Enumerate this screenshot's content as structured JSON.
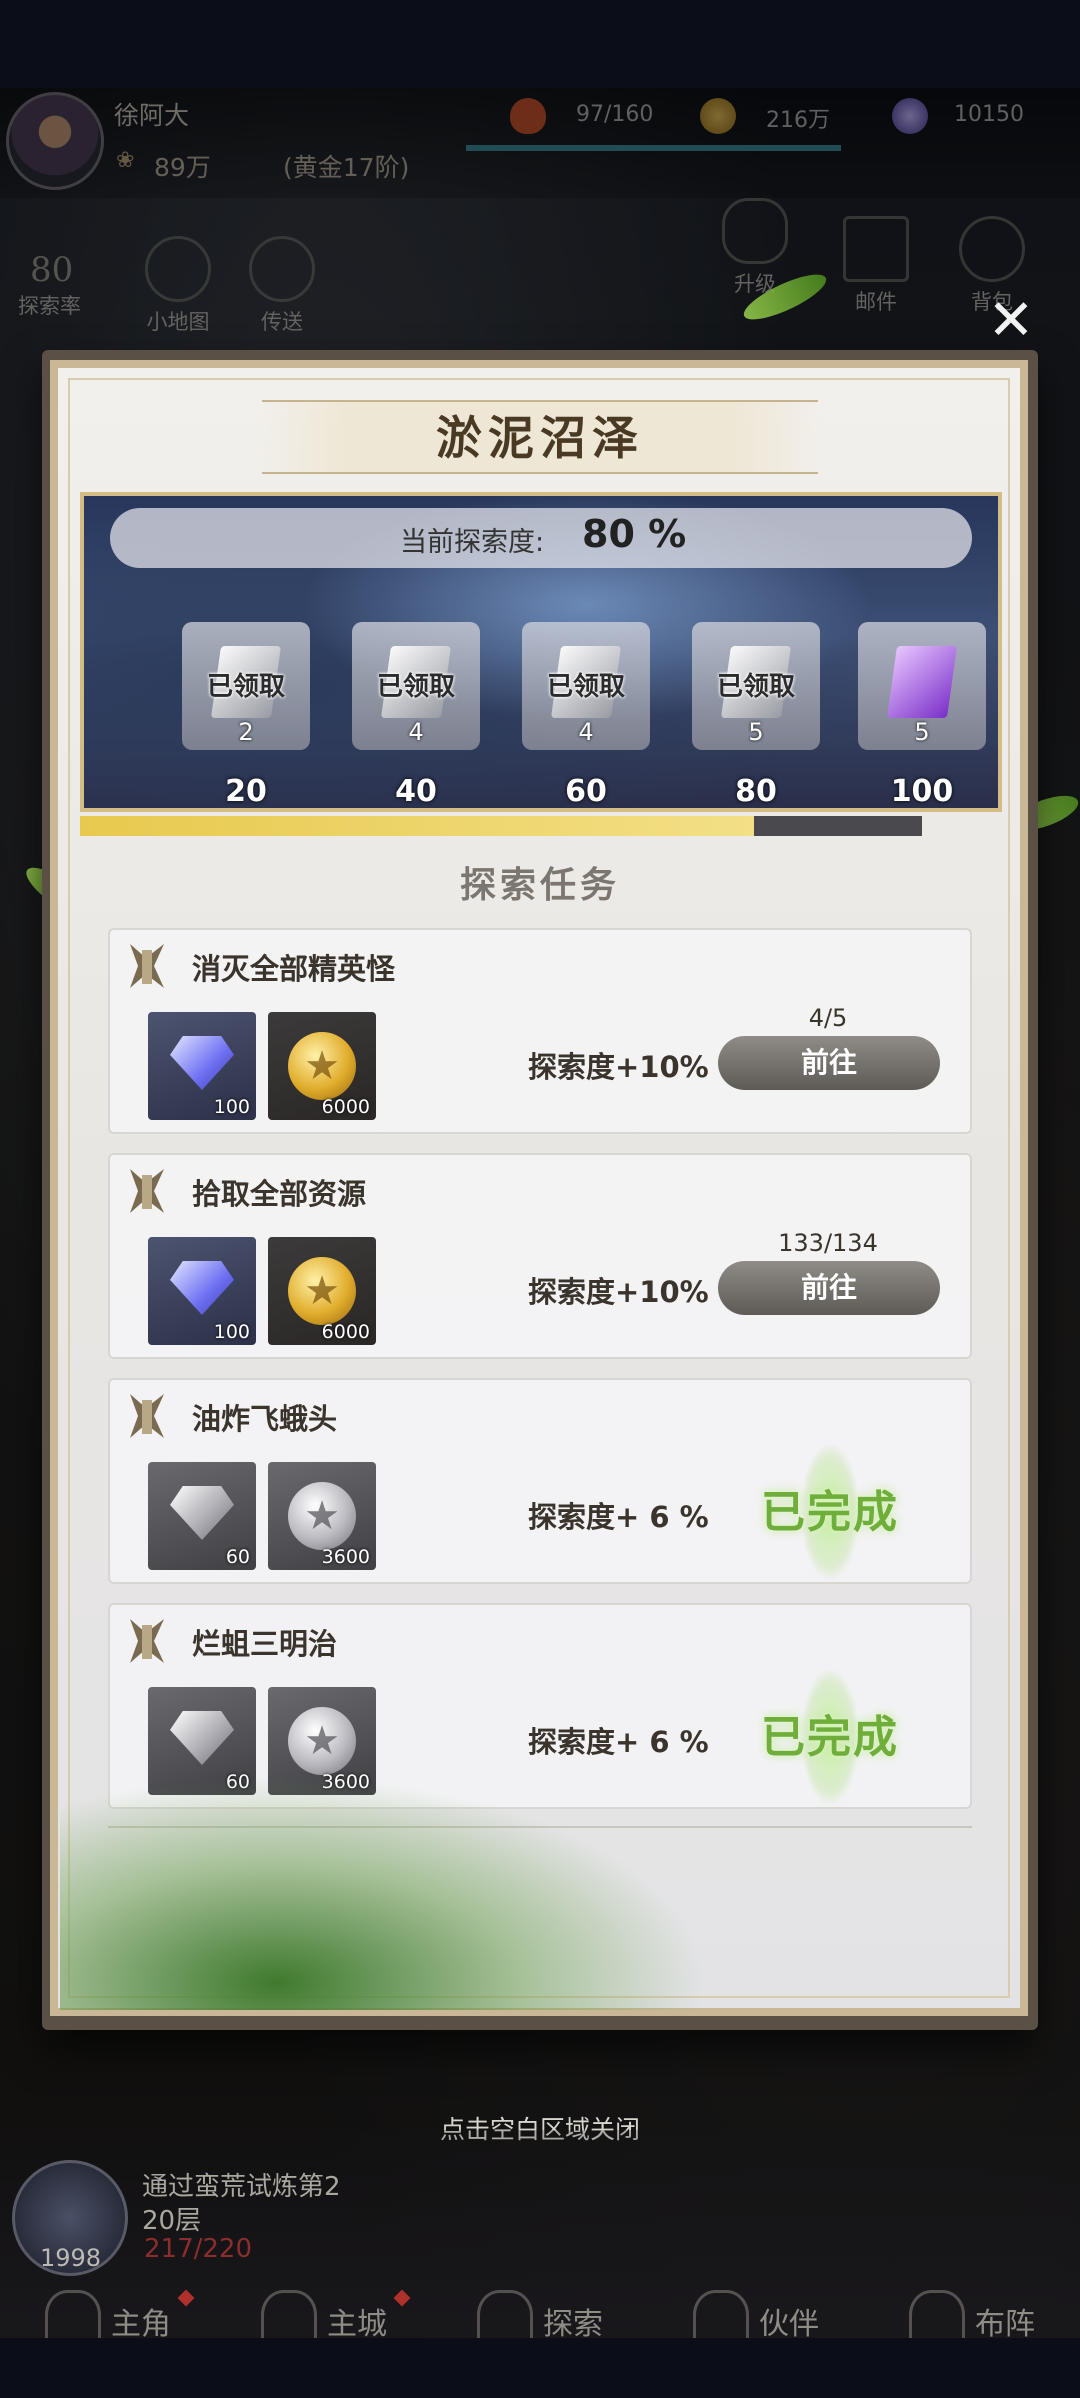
{
  "player": {
    "name": "徐阿大",
    "power": "89万",
    "rank": "(黄金17阶)",
    "resources": {
      "stamina": "97/160",
      "gold": "216万",
      "gems": "10150"
    }
  },
  "hud": {
    "explore_rate_value": "80",
    "explore_rate_label": "探索率",
    "minimap_label": "小地图",
    "teleport_label": "传送",
    "upgrade_label": "升级",
    "mail_label": "邮件",
    "bag_label": "背包"
  },
  "modal": {
    "title": "淤泥沼泽",
    "progress_label": "当前探索度:",
    "progress_value": "80 %",
    "progress_fraction": 0.8,
    "rewards": [
      {
        "status": "已领取",
        "count": "2",
        "milestone": "20",
        "icon": "silver-ticket-icon"
      },
      {
        "status": "已领取",
        "count": "4",
        "milestone": "40",
        "icon": "silver-ticket-icon"
      },
      {
        "status": "已领取",
        "count": "4",
        "milestone": "60",
        "icon": "silver-ticket-icon"
      },
      {
        "status": "已领取",
        "count": "5",
        "milestone": "80",
        "icon": "silver-ticket-icon"
      },
      {
        "status": "",
        "count": "5",
        "milestone": "100",
        "icon": "purple-ticket-icon"
      }
    ],
    "section_title": "探索任务",
    "tasks": [
      {
        "name": "消灭全部精英怪",
        "item1_qty": "100",
        "item2_qty": "6000",
        "gain": "探索度+10%",
        "count": "4/5",
        "button": "前往"
      },
      {
        "name": "拾取全部资源",
        "item1_qty": "100",
        "item2_qty": "6000",
        "gain": "探索度+10%",
        "count": "133/134",
        "button": "前往"
      },
      {
        "name": "油炸飞蛾头",
        "item1_qty": "60",
        "item2_qty": "3600",
        "gain": "探索度+ 6 %",
        "status": "已完成"
      },
      {
        "name": "烂蛆三明治",
        "item1_qty": "60",
        "item2_qty": "3600",
        "gain": "探索度+ 6 %",
        "status": "已完成"
      }
    ],
    "close_hint": "点击空白区域关闭"
  },
  "quest": {
    "level": "1998",
    "text_line1": "通过蛮荒试炼第2",
    "text_line2": "20层",
    "progress": "217/220"
  },
  "nav": [
    {
      "label": "主角"
    },
    {
      "label": "主城"
    },
    {
      "label": "探索"
    },
    {
      "label": "伙伴"
    },
    {
      "label": "布阵"
    }
  ],
  "colors": {
    "progress_fill": "#e7c94e",
    "done_green": "#6fae3a",
    "frame_gold": "#c9b796"
  }
}
